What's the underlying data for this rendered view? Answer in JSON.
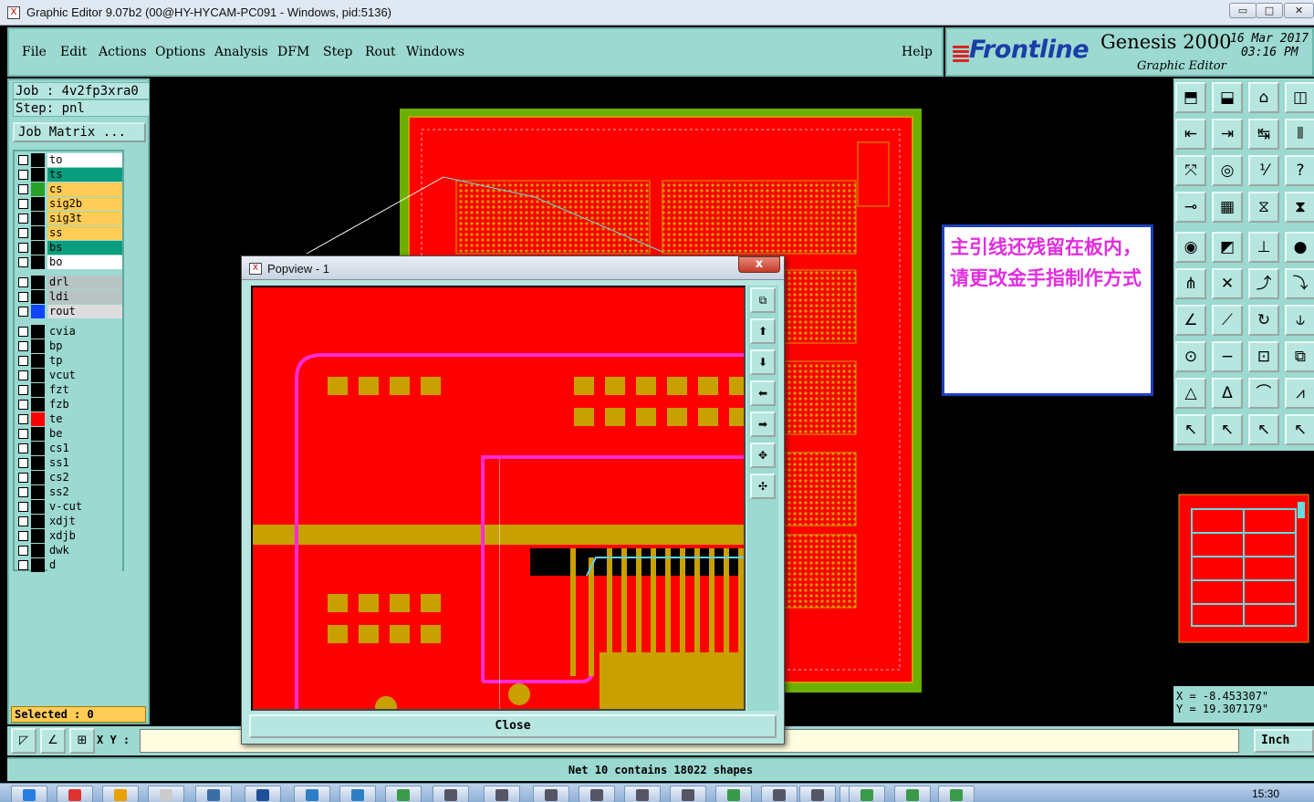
{
  "window": {
    "title": "Graphic Editor 9.07b2 (00@HY-HYCAM-PC091 - Windows, pid:5136)",
    "minimize": "▭",
    "maximize": "□",
    "close": "✕"
  },
  "menu": {
    "file": "File",
    "edit": "Edit",
    "actions": "Actions",
    "options": "Options",
    "analysis": "Analysis",
    "dfm": "DFM",
    "step": "Step",
    "rout": "Rout",
    "windows": "Windows",
    "help": "Help"
  },
  "brand": {
    "logo": "Frontline",
    "product": "Genesis 2000",
    "subtitle": "Graphic Editor",
    "date": "16 Mar 2017",
    "time": "03:16 PM"
  },
  "job": {
    "job_label": "Job : 4v2fp3xra0",
    "step_label": "Step: pnl",
    "matrix_button": "Job Matrix ..."
  },
  "layers": [
    {
      "name": "to",
      "swatch": "#000000",
      "bg": "#ffffff"
    },
    {
      "name": "ts",
      "swatch": "#000000",
      "bg": "#0a9d7e"
    },
    {
      "name": "cs",
      "swatch": "#2aa02a",
      "bg": "#ffcc55"
    },
    {
      "name": "sig2b",
      "swatch": "#000000",
      "bg": "#ffcc55"
    },
    {
      "name": "sig3t",
      "swatch": "#000000",
      "bg": "#ffcc55"
    },
    {
      "name": "ss",
      "swatch": "#000000",
      "bg": "#ffcc55"
    },
    {
      "name": "bs",
      "swatch": "#000000",
      "bg": "#0a9d7e"
    },
    {
      "name": "bo",
      "swatch": "#000000",
      "bg": "#ffffff"
    },
    {
      "name": "drl",
      "swatch": "#000000",
      "bg": "#b8c4c4"
    },
    {
      "name": "ldi",
      "swatch": "#000000",
      "bg": "#b8c4c4"
    },
    {
      "name": "rout",
      "swatch": "#1144ff",
      "bg": "#dddddd"
    },
    {
      "name": "cvia",
      "swatch": "#000000",
      "bg": "#9cd9d0"
    },
    {
      "name": "bp",
      "swatch": "#000000",
      "bg": "#9cd9d0"
    },
    {
      "name": "tp",
      "swatch": "#000000",
      "bg": "#9cd9d0"
    },
    {
      "name": "vcut",
      "swatch": "#000000",
      "bg": "#9cd9d0"
    },
    {
      "name": "fzt",
      "swatch": "#000000",
      "bg": "#9cd9d0"
    },
    {
      "name": "fzb",
      "swatch": "#000000",
      "bg": "#9cd9d0"
    },
    {
      "name": "te",
      "swatch": "#ff0000",
      "bg": "#9cd9d0"
    },
    {
      "name": "be",
      "swatch": "#000000",
      "bg": "#9cd9d0"
    },
    {
      "name": "cs1",
      "swatch": "#000000",
      "bg": "#9cd9d0"
    },
    {
      "name": "ss1",
      "swatch": "#000000",
      "bg": "#9cd9d0"
    },
    {
      "name": "cs2",
      "swatch": "#000000",
      "bg": "#9cd9d0"
    },
    {
      "name": "ss2",
      "swatch": "#000000",
      "bg": "#9cd9d0"
    },
    {
      "name": "v-cut",
      "swatch": "#000000",
      "bg": "#9cd9d0"
    },
    {
      "name": "xdjt",
      "swatch": "#000000",
      "bg": "#9cd9d0"
    },
    {
      "name": "xdjb",
      "swatch": "#000000",
      "bg": "#9cd9d0"
    },
    {
      "name": "dwk",
      "swatch": "#000000",
      "bg": "#9cd9d0"
    },
    {
      "name": "d",
      "swatch": "#000000",
      "bg": "#9cd9d0"
    }
  ],
  "selected_label": "Selected : 0",
  "note": {
    "text": "主引线还残留在板内，请更改金手指制作方式"
  },
  "popview": {
    "title": "Popview - 1",
    "close_x": "x",
    "close_button": "Close"
  },
  "coords": {
    "x": "X = -8.453307\"",
    "y": "Y = 19.307179\""
  },
  "cmd": {
    "xy_label": "X Y :",
    "units": "Inch"
  },
  "status": "Net 10 contains 18022 shapes",
  "taskbar": {
    "clock": "15:30"
  },
  "colors": {
    "panel": "#9cd9d0",
    "board_red": "#ff0000",
    "gold": "#c8a000",
    "trace_magenta": "#ff2bd6",
    "note_text": "#e22de0",
    "board_frame": "#6bb000"
  }
}
